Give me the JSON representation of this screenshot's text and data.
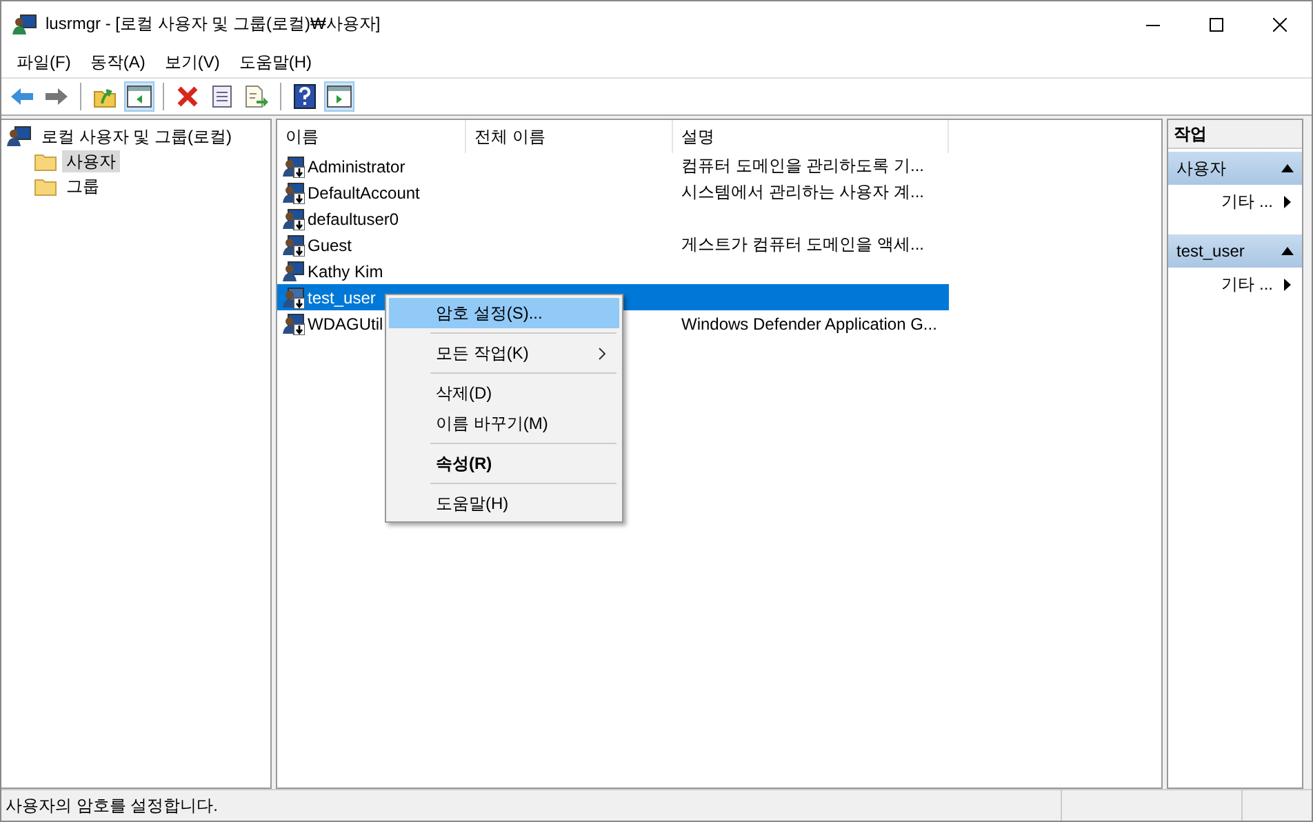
{
  "window": {
    "title": "lusrmgr - [로컬 사용자 및 그룹(로컬)₩사용자]"
  },
  "menu_bar": [
    "파일(F)",
    "동작(A)",
    "보기(V)",
    "도움말(H)"
  ],
  "toolbar": [
    {
      "kind": "back",
      "pressed": false
    },
    {
      "kind": "forward",
      "pressed": false
    },
    {
      "kind": "separator"
    },
    {
      "kind": "up",
      "pressed": false
    },
    {
      "kind": "tree",
      "pressed": true
    },
    {
      "kind": "separator"
    },
    {
      "kind": "delete",
      "pressed": false
    },
    {
      "kind": "properties",
      "pressed": false
    },
    {
      "kind": "export",
      "pressed": false
    },
    {
      "kind": "separator"
    },
    {
      "kind": "help",
      "pressed": false
    },
    {
      "kind": "actionpane",
      "pressed": true
    }
  ],
  "tree": {
    "label": "로컬 사용자 및 그룹(로컬)",
    "children": [
      {
        "label": "사용자",
        "selected": true
      },
      {
        "label": "그룹",
        "selected": false
      }
    ]
  },
  "table": {
    "columns": [
      "이름",
      "전체 이름",
      "설명"
    ],
    "rows": [
      {
        "name": "Administrator",
        "full_name": "",
        "description": "컴퓨터 도메인을 관리하도록 기...",
        "disabled": true,
        "selected": false
      },
      {
        "name": "DefaultAccount",
        "full_name": "",
        "description": "시스템에서 관리하는 사용자 계...",
        "disabled": true,
        "selected": false
      },
      {
        "name": "defaultuser0",
        "full_name": "",
        "description": "",
        "disabled": true,
        "selected": false
      },
      {
        "name": "Guest",
        "full_name": "",
        "description": "게스트가 컴퓨터 도메인을 액세...",
        "disabled": true,
        "selected": false
      },
      {
        "name": "Kathy Kim",
        "full_name": "",
        "description": "",
        "disabled": false,
        "selected": false
      },
      {
        "name": "test_user",
        "full_name": "",
        "description": "",
        "disabled": true,
        "selected": true
      },
      {
        "name": "WDAGUtil",
        "full_name": "",
        "description": "Windows Defender Application G...",
        "disabled": true,
        "selected": false
      }
    ]
  },
  "actions": {
    "title": "작업",
    "groups": [
      {
        "title": "사용자",
        "items": [
          "기타 ..."
        ]
      },
      {
        "title": "test_user",
        "items": [
          "기타 ..."
        ]
      }
    ]
  },
  "context_menu": [
    {
      "kind": "item",
      "label": "암호 설정(S)...",
      "selected": true,
      "bold": false,
      "submenu": false
    },
    {
      "kind": "separator"
    },
    {
      "kind": "item",
      "label": "모든 작업(K)",
      "selected": false,
      "bold": false,
      "submenu": true
    },
    {
      "kind": "separator"
    },
    {
      "kind": "item",
      "label": "삭제(D)",
      "selected": false,
      "bold": false,
      "submenu": false
    },
    {
      "kind": "item",
      "label": "이름 바꾸기(M)",
      "selected": false,
      "bold": false,
      "submenu": false
    },
    {
      "kind": "separator"
    },
    {
      "kind": "item",
      "label": "속성(R)",
      "selected": false,
      "bold": true,
      "submenu": false
    },
    {
      "kind": "separator"
    },
    {
      "kind": "item",
      "label": "도움말(H)",
      "selected": false,
      "bold": false,
      "submenu": false
    }
  ],
  "status_bar": {
    "text": "사용자의 암호를 설정합니다."
  }
}
